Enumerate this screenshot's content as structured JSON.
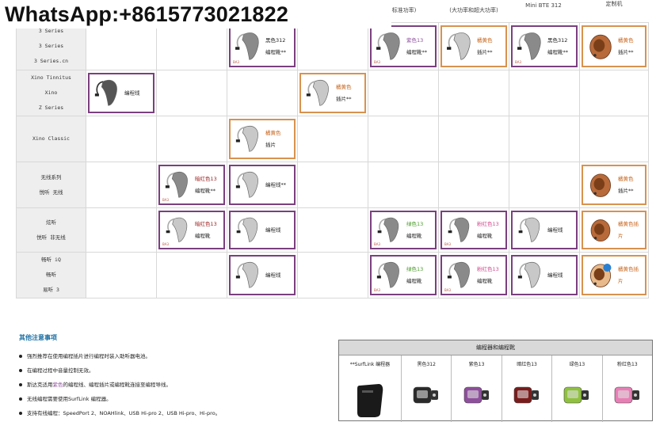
{
  "watermark": "WhatsApp:+8615773021822",
  "column_headers": [
    "标准功率)",
    "(大功率和超大功率)",
    "Mini BTE 312",
    "定制机"
  ],
  "rows": [
    {
      "labels": [
        "3 Series",
        "3 Series",
        "3 Series.cn"
      ],
      "cells": [
        {
          "col": 3,
          "color": "purple",
          "lines": [
            "黑色312",
            "编程靴**"
          ],
          "tag": "BA3",
          "device": "grey"
        },
        {
          "col": 5,
          "color": "purple",
          "lines": [
            "紫色13",
            "编程靴**"
          ],
          "tag": "BA3",
          "device": "grey"
        },
        {
          "col": 6,
          "color": "orange",
          "lines": [
            "橘黄色",
            "插片**"
          ],
          "tag": "",
          "device": "silver"
        },
        {
          "col": 7,
          "color": "purple",
          "lines": [
            "黑色312",
            "编程靴**"
          ],
          "tag": "BA3",
          "device": "grey"
        },
        {
          "col": 8,
          "color": "orange",
          "lines": [
            "橘黄色",
            "插片**"
          ],
          "tag": "",
          "device": "custom"
        }
      ]
    },
    {
      "labels": [
        "Xino Tinnitus",
        "Xino",
        "Z Series"
      ],
      "cells": [
        {
          "col": 1,
          "color": "purple",
          "lines": [
            "编程线"
          ],
          "tag": "",
          "device": "dark"
        },
        {
          "col": 4,
          "color": "orange",
          "lines": [
            "橘黄色",
            "插片**"
          ],
          "tag": "",
          "device": "silver"
        }
      ]
    },
    {
      "labels": [
        "Xino Classic"
      ],
      "cells": [
        {
          "col": 3,
          "color": "orange",
          "lines": [
            "橘黄色",
            "插片"
          ],
          "tag": "",
          "device": "silver"
        }
      ]
    },
    {
      "labels": [
        "无线系列",
        "悦听 无线"
      ],
      "cells": [
        {
          "col": 2,
          "color": "purple",
          "lines": [
            "暗红色13",
            "编程靴**"
          ],
          "tag": "BA3",
          "device": "grey"
        },
        {
          "col": 3,
          "color": "purple",
          "lines": [
            "编程线**"
          ],
          "tag": "",
          "device": "silver"
        },
        {
          "col": 8,
          "color": "orange",
          "lines": [
            "橘黄色",
            "插片**"
          ],
          "tag": "",
          "device": "custom"
        }
      ]
    },
    {
      "labels": [
        "炫听",
        "悦听 非无线"
      ],
      "cells": [
        {
          "col": 2,
          "color": "purple",
          "lines": [
            "暗红色13",
            "编程靴"
          ],
          "tag": "BA3",
          "device": "silver"
        },
        {
          "col": 3,
          "color": "purple",
          "lines": [
            "编程线"
          ],
          "tag": "",
          "device": "silver"
        },
        {
          "col": 5,
          "color": "purple",
          "lines": [
            "绿色13",
            "编程靴"
          ],
          "tag": "BA3",
          "device": "grey"
        },
        {
          "col": 6,
          "color": "purple",
          "lines": [
            "粉红色13",
            "编程靴"
          ],
          "tag": "BA3",
          "device": "grey"
        },
        {
          "col": 7,
          "color": "purple",
          "lines": [
            "编程线"
          ],
          "tag": "",
          "device": "silver"
        },
        {
          "col": 8,
          "color": "orange",
          "lines": [
            "橘黄色插片"
          ],
          "tag": "",
          "device": "custom"
        }
      ]
    },
    {
      "labels": [
        "畅听 iQ",
        "畅听",
        "易听 3"
      ],
      "cells": [
        {
          "col": 3,
          "color": "purple",
          "lines": [
            "编程线"
          ],
          "tag": "",
          "device": "silver"
        },
        {
          "col": 5,
          "color": "purple",
          "lines": [
            "绿色13",
            "编程靴"
          ],
          "tag": "BA3",
          "device": "grey"
        },
        {
          "col": 6,
          "color": "purple",
          "lines": [
            "粉红色13",
            "编程靴"
          ],
          "tag": "BA3",
          "device": "grey"
        },
        {
          "col": 7,
          "color": "purple",
          "lines": [
            "编程线"
          ],
          "tag": "",
          "device": "silver"
        },
        {
          "col": 8,
          "color": "orange",
          "lines": [
            "橘黄色插片"
          ],
          "tag": "",
          "device": "custom2"
        }
      ]
    }
  ],
  "notes": {
    "title": "其他注意事项",
    "items": [
      "强烈推荐在使用编程插片进行编程时装入助听器电池。",
      "在编程过程中音量控制无效。",
      "斯达克适用紫色的编程线、编程插片或编程靴连接至编程导线。",
      "无线编程需要使用SurfLink 编程器。",
      "支持有线编程：SpeedPort 2、NOAHlink、USB Hi-pro 2、USB Hi-pro、Hi-pro。"
    ]
  },
  "programmer": {
    "title": "编程器和编程靴",
    "items": [
      {
        "label": "**SurfLink 编程器",
        "color": "#1a1a1a",
        "kind": "surflink"
      },
      {
        "label": "黑色312",
        "color": "#2a2a2a",
        "kind": "boot"
      },
      {
        "label": "紫色13",
        "color": "#8e4f9c",
        "kind": "boot"
      },
      {
        "label": "暗红色13",
        "color": "#7a1c1c",
        "kind": "boot"
      },
      {
        "label": "绿色13",
        "color": "#8fc13f",
        "kind": "boot"
      },
      {
        "label": "粉红色13",
        "color": "#e77fb5",
        "kind": "boot"
      }
    ]
  },
  "colors": {
    "purple_border": "#7b3f7f",
    "orange_border": "#d8924f",
    "notes_title": "#1b6fa3"
  }
}
